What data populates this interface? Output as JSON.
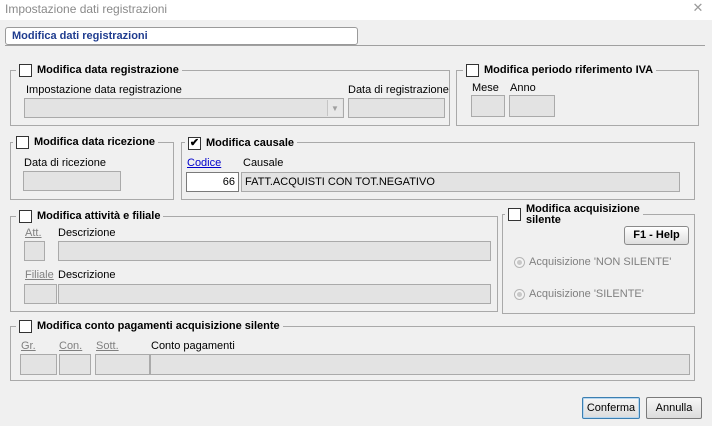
{
  "window": {
    "title": "Impostazione dati registrazioni",
    "close_glyph": "✕"
  },
  "header": {
    "title": "Modifica dati registrazioni"
  },
  "data_registrazione": {
    "checkbox_label": "Modifica data registrazione",
    "checked": false,
    "impostazione_label": "Impostazione data registrazione",
    "impostazione_value": "",
    "data_label": "Data di registrazione",
    "data_value": ""
  },
  "periodo_iva": {
    "checkbox_label": "Modifica periodo riferimento IVA",
    "checked": false,
    "mese_label": "Mese",
    "anno_label": "Anno",
    "mese_value": "",
    "anno_value": ""
  },
  "data_ricezione": {
    "checkbox_label": "Modifica data ricezione",
    "checked": false,
    "data_label": "Data di ricezione",
    "data_value": ""
  },
  "causale": {
    "checkbox_label": "Modifica causale",
    "checked": true,
    "check_glyph": "✔",
    "codice_label": "Codice",
    "causale_label": "Causale",
    "codice_value": "66",
    "causale_value": "FATT.ACQUISTI CON TOT.NEGATIVO"
  },
  "attivita_filiale": {
    "checkbox_label": "Modifica attività e filiale",
    "checked": false,
    "att_label": "Att.",
    "descrizione_label": "Descrizione",
    "filiale_label": "Filiale",
    "descrizione2_label": "Descrizione"
  },
  "acquisizione_silente": {
    "checkbox_label_line1": "Modifica acquisizione",
    "checkbox_label_line2": "silente",
    "checked": false,
    "help_label": "F1 - Help",
    "option_non_silente": "Acquisizione 'NON SILENTE'",
    "option_silente": "Acquisizione 'SILENTE'"
  },
  "conto_pagamenti": {
    "checkbox_label": "Modifica conto pagamenti acquisizione silente",
    "checked": false,
    "gr_label": "Gr.",
    "con_label": "Con.",
    "sott_label": "Sott.",
    "conto_label": "Conto pagamenti"
  },
  "footer": {
    "confirm_label": "Conferma",
    "cancel_label": "Annulla"
  }
}
